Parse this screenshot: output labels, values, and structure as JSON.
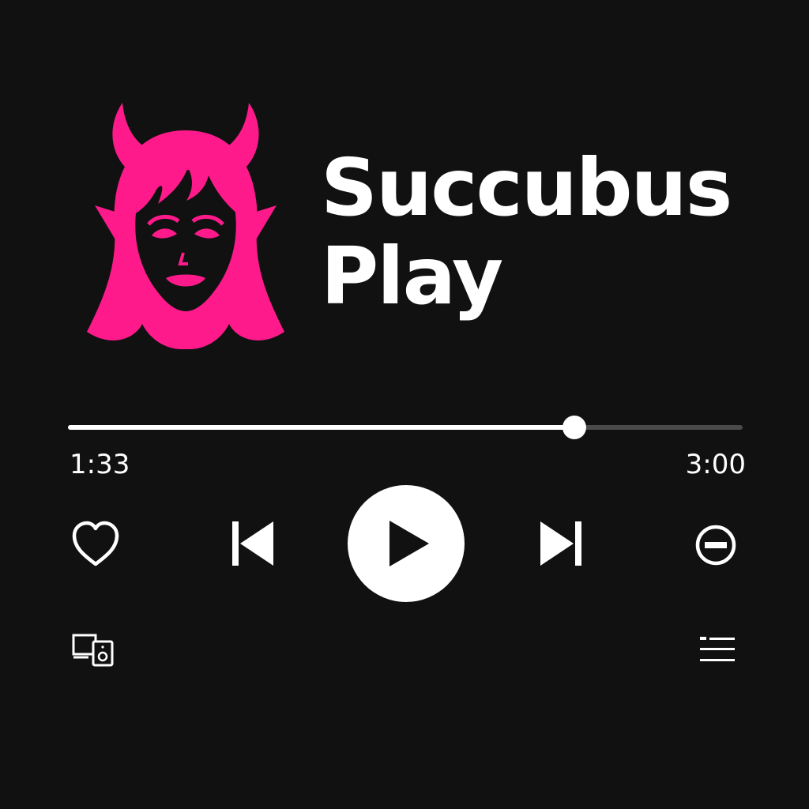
{
  "app": {
    "title_line1": "Succubus",
    "title_line2": "Play",
    "logo_icon": "succubus-logo-icon"
  },
  "player": {
    "elapsed": "1:33",
    "total": "3:00",
    "progress": 0.75,
    "state": "paused"
  },
  "controls": {
    "like": "heart-icon",
    "previous": "skip-previous-icon",
    "play": "play-icon",
    "next": "skip-next-icon",
    "remove": "minus-circle-icon",
    "devices": "connect-devices-icon",
    "queue": "queue-icon"
  },
  "colors": {
    "background": "#111111",
    "accent": "#ff1a8c",
    "foreground": "#ffffff",
    "track": "#4a4a4a"
  }
}
